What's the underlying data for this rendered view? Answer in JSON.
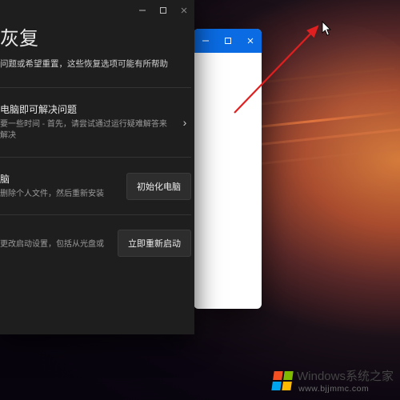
{
  "wallpaper": {
    "desc": "dark abstract wave wallpaper"
  },
  "backWindow": {
    "titlebarColor": "#0a6be2",
    "controls": {
      "minimize": "—",
      "maximize": "□",
      "close": "✕"
    }
  },
  "settings": {
    "controls": {
      "minimize": "—",
      "maximize": "□",
      "close": "✕"
    },
    "title": "灰复",
    "desc": "问题或希望重置，这些恢复选项可能有所帮助",
    "section1": {
      "title": "电脑即可解决问题",
      "sub": "要一些时间 - 首先，请尝试通过运行疑难解答来解决",
      "chevron": "›"
    },
    "section2": {
      "title": "脑",
      "sub": "删除个人文件，然后重新安装",
      "button": "初始化电脑"
    },
    "section3": {
      "title": "",
      "sub": "更改启动设置，包括从光盘或",
      "button": "立即重新启动"
    }
  },
  "annotation": {
    "arrowColor": "#e02020"
  },
  "watermark": {
    "brand": "Windows",
    "tagline": "系统之家",
    "url": "www.bjjmmc.com"
  }
}
